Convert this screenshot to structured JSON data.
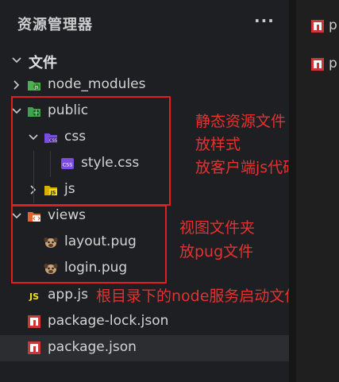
{
  "sidebar": {
    "title": "资源管理器",
    "more": "···",
    "section": "文件"
  },
  "tree": {
    "node_modules": "node_modules",
    "public": "public",
    "css": "css",
    "style_css": "style.css",
    "js": "js",
    "views": "views",
    "layout_pug": "layout.pug",
    "login_pug": "login.pug",
    "app_js": "app.js",
    "package_lock": "package-lock.json",
    "package_json": "package.json"
  },
  "annotations": {
    "public_lines": [
      "静态资源文件",
      "放样式",
      "放客户端js代码"
    ],
    "views_lines": [
      "视图文件夹",
      "放pug文件"
    ],
    "root_note": "根目录下的node服务启动文件"
  },
  "editor": {
    "tabs": [
      "p",
      "p"
    ]
  },
  "colors": {
    "annotation_red": "#e02020",
    "npm_red": "#cb3837",
    "js_yellow": "#f5de19",
    "css_purple": "#7a4ce0",
    "node_green": "#4caf50"
  }
}
